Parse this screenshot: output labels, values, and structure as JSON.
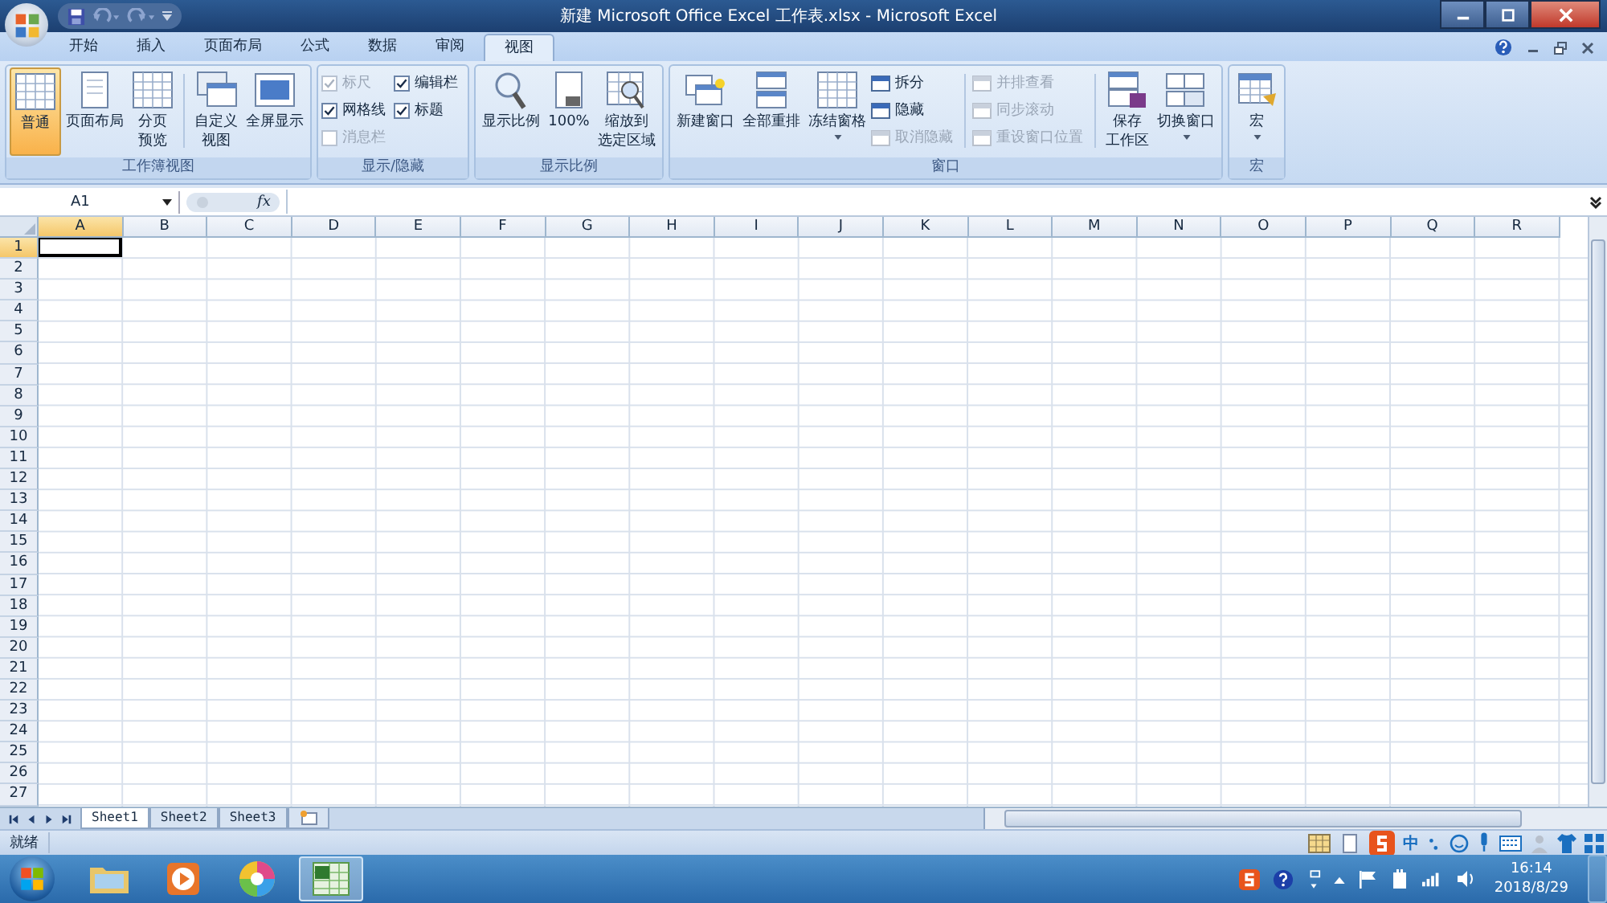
{
  "window": {
    "title": "新建 Microsoft Office Excel 工作表.xlsx - Microsoft Excel"
  },
  "tabs": [
    {
      "label": "开始",
      "selected": false
    },
    {
      "label": "插入",
      "selected": false
    },
    {
      "label": "页面布局",
      "selected": false
    },
    {
      "label": "公式",
      "selected": false
    },
    {
      "label": "数据",
      "selected": false
    },
    {
      "label": "审阅",
      "selected": false
    },
    {
      "label": "视图",
      "selected": true
    }
  ],
  "ribbon": {
    "groups": [
      {
        "label": "工作簿视图",
        "controls": [
          {
            "kind": "large",
            "lines": [
              "普通"
            ],
            "selected": true
          },
          {
            "kind": "large",
            "lines": [
              "页面布局"
            ],
            "selected": false
          },
          {
            "kind": "large",
            "lines": [
              "分页",
              "预览"
            ],
            "selected": false
          },
          {
            "kind": "separator"
          },
          {
            "kind": "large",
            "lines": [
              "自定义",
              "视图"
            ],
            "selected": false
          },
          {
            "kind": "large",
            "lines": [
              "全屏显示"
            ],
            "selected": false
          }
        ]
      },
      {
        "label": "显示/隐藏",
        "controls": [
          {
            "kind": "stack",
            "items": [
              {
                "kind": "check",
                "label": "标尺",
                "checked": true,
                "disabled": true
              },
              {
                "kind": "check",
                "label": "网格线",
                "checked": true,
                "disabled": false
              },
              {
                "kind": "check",
                "label": "消息栏",
                "checked": false,
                "disabled": true
              }
            ]
          },
          {
            "kind": "stack",
            "items": [
              {
                "kind": "check",
                "label": "编辑栏",
                "checked": true,
                "disabled": false
              },
              {
                "kind": "check",
                "label": "标题",
                "checked": true,
                "disabled": false
              }
            ]
          }
        ]
      },
      {
        "label": "显示比例",
        "controls": [
          {
            "kind": "large",
            "lines": [
              "显示比例"
            ],
            "selected": false
          },
          {
            "kind": "large",
            "lines": [
              "100%"
            ],
            "selected": false
          },
          {
            "kind": "large",
            "lines": [
              "缩放到",
              "选定区域"
            ],
            "selected": false
          }
        ]
      },
      {
        "label": "窗口",
        "controls": [
          {
            "kind": "large",
            "lines": [
              "新建窗口"
            ],
            "selected": false
          },
          {
            "kind": "large",
            "lines": [
              "全部重排"
            ],
            "selected": false
          },
          {
            "kind": "large",
            "lines": [
              "冻结窗格"
            ],
            "selected": false,
            "dropdown": true
          },
          {
            "kind": "stack",
            "items": [
              {
                "kind": "small",
                "label": "拆分",
                "disabled": false
              },
              {
                "kind": "small",
                "label": "隐藏",
                "disabled": false
              },
              {
                "kind": "small",
                "label": "取消隐藏",
                "disabled": true
              }
            ]
          },
          {
            "kind": "separator"
          },
          {
            "kind": "stack",
            "items": [
              {
                "kind": "small",
                "label": "并排查看",
                "disabled": true
              },
              {
                "kind": "small",
                "label": "同步滚动",
                "disabled": true
              },
              {
                "kind": "small",
                "label": "重设窗口位置",
                "disabled": true
              }
            ]
          },
          {
            "kind": "separator"
          },
          {
            "kind": "large",
            "lines": [
              "保存",
              "工作区"
            ],
            "selected": false
          },
          {
            "kind": "large",
            "lines": [
              "切换窗口"
            ],
            "selected": false,
            "dropdown": true
          }
        ]
      },
      {
        "label": "宏",
        "controls": [
          {
            "kind": "large",
            "lines": [
              "宏"
            ],
            "selected": false,
            "dropdown": true
          }
        ]
      }
    ]
  },
  "name_box": {
    "value": "A1"
  },
  "formula_bar": {
    "function_label": "fx"
  },
  "columns": [
    {
      "label": "A",
      "selected": true
    },
    {
      "label": "B",
      "selected": false
    },
    {
      "label": "C",
      "selected": false
    },
    {
      "label": "D",
      "selected": false
    },
    {
      "label": "E",
      "selected": false
    },
    {
      "label": "F",
      "selected": false
    },
    {
      "label": "G",
      "selected": false
    },
    {
      "label": "H",
      "selected": false
    },
    {
      "label": "I",
      "selected": false
    },
    {
      "label": "J",
      "selected": false
    },
    {
      "label": "K",
      "selected": false
    },
    {
      "label": "L",
      "selected": false
    },
    {
      "label": "M",
      "selected": false
    },
    {
      "label": "N",
      "selected": false
    },
    {
      "label": "O",
      "selected": false
    },
    {
      "label": "P",
      "selected": false
    },
    {
      "label": "Q",
      "selected": false
    },
    {
      "label": "R",
      "selected": false
    }
  ],
  "rows": [
    {
      "label": "1",
      "selected": true
    },
    {
      "label": "2",
      "selected": false
    },
    {
      "label": "3",
      "selected": false
    },
    {
      "label": "4",
      "selected": false
    },
    {
      "label": "5",
      "selected": false
    },
    {
      "label": "6",
      "selected": false
    },
    {
      "label": "7",
      "selected": false
    },
    {
      "label": "8",
      "selected": false
    },
    {
      "label": "9",
      "selected": false
    },
    {
      "label": "10",
      "selected": false
    },
    {
      "label": "11",
      "selected": false
    },
    {
      "label": "12",
      "selected": false
    },
    {
      "label": "13",
      "selected": false
    },
    {
      "label": "14",
      "selected": false
    },
    {
      "label": "15",
      "selected": false
    },
    {
      "label": "16",
      "selected": false
    },
    {
      "label": "17",
      "selected": false
    },
    {
      "label": "18",
      "selected": false
    },
    {
      "label": "19",
      "selected": false
    },
    {
      "label": "20",
      "selected": false
    },
    {
      "label": "21",
      "selected": false
    },
    {
      "label": "22",
      "selected": false
    },
    {
      "label": "23",
      "selected": false
    },
    {
      "label": "24",
      "selected": false
    },
    {
      "label": "25",
      "selected": false
    },
    {
      "label": "26",
      "selected": false
    },
    {
      "label": "27",
      "selected": false
    }
  ],
  "sheet_tabs": [
    {
      "label": "Sheet1",
      "selected": true
    },
    {
      "label": "Sheet2",
      "selected": false
    },
    {
      "label": "Sheet3",
      "selected": false
    }
  ],
  "status_bar": {
    "text": "就绪",
    "ime_label": "中"
  },
  "taskbar": {
    "apps": [
      {
        "kind": "folder",
        "selected": false
      },
      {
        "kind": "player",
        "selected": false
      },
      {
        "kind": "pinwheel",
        "selected": false
      },
      {
        "kind": "excel",
        "selected": true
      }
    ],
    "clock": {
      "time": "16:14",
      "date": "2018/8/29"
    }
  }
}
